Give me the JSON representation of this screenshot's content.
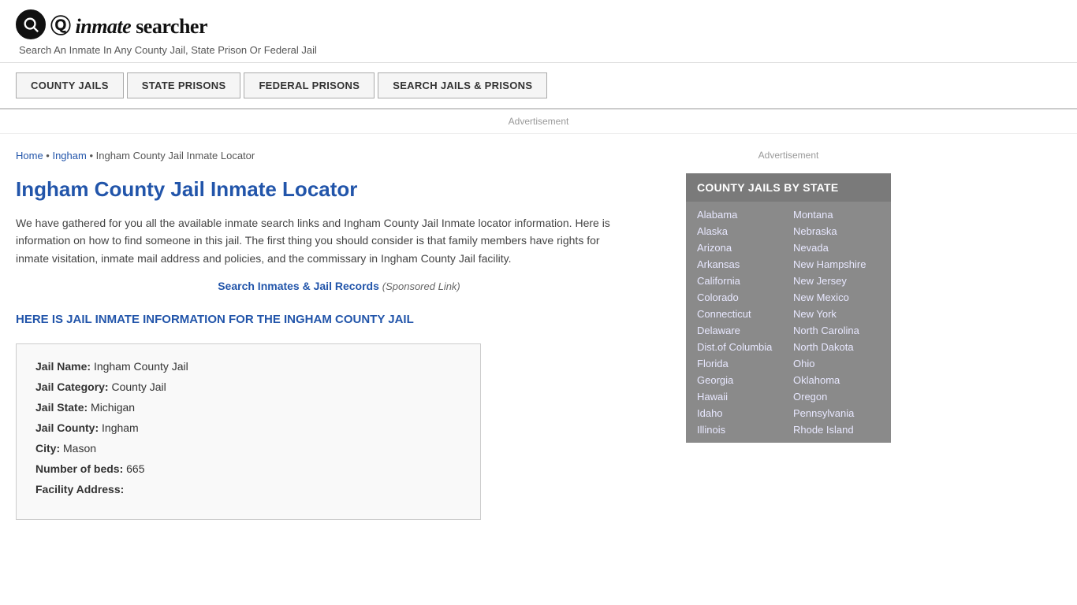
{
  "header": {
    "logo_text": "inmate searcher",
    "tagline": "Search An Inmate In Any County Jail, State Prison Or Federal Jail"
  },
  "nav": {
    "buttons": [
      {
        "label": "COUNTY JAILS",
        "key": "county-jails"
      },
      {
        "label": "STATE PRISONS",
        "key": "state-prisons"
      },
      {
        "label": "FEDERAL PRISONS",
        "key": "federal-prisons"
      },
      {
        "label": "SEARCH JAILS & PRISONS",
        "key": "search-jails"
      }
    ]
  },
  "ad": {
    "label": "Advertisement"
  },
  "breadcrumb": {
    "home": "Home",
    "separator1": " • ",
    "ingham": "Ingham",
    "separator2": " • ",
    "current": "Ingham County Jail Inmate Locator"
  },
  "page_title": "Ingham County Jail Inmate Locator",
  "description": "We have gathered for you all the available inmate search links and Ingham County Jail Inmate locator information. Here is information on how to find someone in this jail. The first thing you should consider is that family members have rights for inmate visitation, inmate mail address and policies, and the commissary in Ingham County Jail facility.",
  "sponsored": {
    "link_text": "Search Inmates & Jail Records",
    "label": "(Sponsored Link)"
  },
  "section_heading": "HERE IS JAIL INMATE INFORMATION FOR THE INGHAM COUNTY JAIL",
  "jail_info": {
    "name_label": "Jail Name:",
    "name_value": "Ingham County Jail",
    "category_label": "Jail Category:",
    "category_value": "County Jail",
    "state_label": "Jail State:",
    "state_value": "Michigan",
    "county_label": "Jail County:",
    "county_value": "Ingham",
    "city_label": "City:",
    "city_value": "Mason",
    "beds_label": "Number of beds:",
    "beds_value": "665",
    "address_label": "Facility Address:"
  },
  "sidebar": {
    "ad_label": "Advertisement",
    "state_box_title": "COUNTY JAILS BY STATE",
    "states_col1": [
      "Alabama",
      "Alaska",
      "Arizona",
      "Arkansas",
      "California",
      "Colorado",
      "Connecticut",
      "Delaware",
      "Dist.of Columbia",
      "Florida",
      "Georgia",
      "Hawaii",
      "Idaho",
      "Illinois"
    ],
    "states_col2": [
      "Montana",
      "Nebraska",
      "Nevada",
      "New Hampshire",
      "New Jersey",
      "New Mexico",
      "New York",
      "North Carolina",
      "North Dakota",
      "Ohio",
      "Oklahoma",
      "Oregon",
      "Pennsylvania",
      "Rhode Island"
    ]
  }
}
